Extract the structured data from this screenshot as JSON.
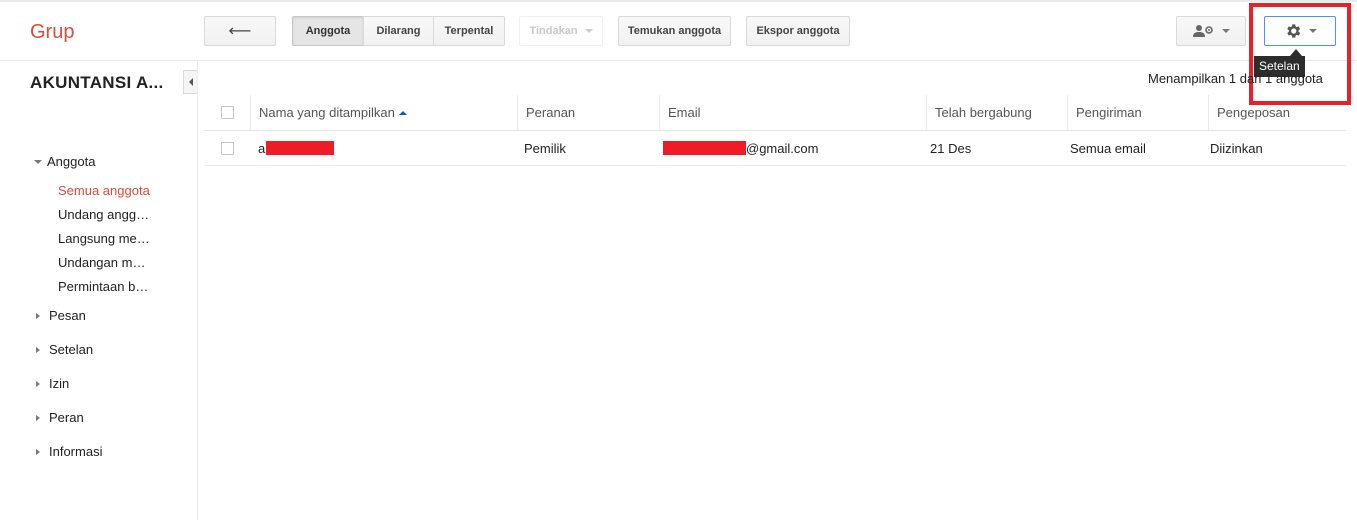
{
  "app": {
    "title": "Grup"
  },
  "toolbar": {
    "back_label": "⟵",
    "tabs": [
      {
        "label": "Anggota",
        "selected": true
      },
      {
        "label": "Dilarang",
        "selected": false
      },
      {
        "label": "Terpental",
        "selected": false
      }
    ],
    "actions_label": "Tindakan",
    "find_members_label": "Temukan anggota",
    "export_members_label": "Ekspor anggota",
    "add_member_icon": "person-add-icon",
    "settings_icon": "gear-icon",
    "settings_tooltip": "Setelan"
  },
  "sidebar": {
    "group_name": "AKUNTANSI A...",
    "sections": [
      {
        "label": "Anggota",
        "expanded": true
      },
      {
        "label": "Pesan",
        "expanded": false
      },
      {
        "label": "Setelan",
        "expanded": false
      },
      {
        "label": "Izin",
        "expanded": false
      },
      {
        "label": "Peran",
        "expanded": false
      },
      {
        "label": "Informasi",
        "expanded": false
      }
    ],
    "members_subitems": [
      {
        "label": "Semua anggota",
        "active": true
      },
      {
        "label": "Undang angg…",
        "active": false
      },
      {
        "label": "Langsung me…",
        "active": false
      },
      {
        "label": "Undangan m…",
        "active": false
      },
      {
        "label": "Permintaan b…",
        "active": false
      }
    ]
  },
  "main": {
    "count_label": "Menampilkan 1 dari 1 anggota",
    "table": {
      "columns": [
        "Nama yang ditampilkan",
        "Peranan",
        "Email",
        "Telah bergabung",
        "Pengiriman",
        "Pengeposan"
      ],
      "sort_column": "Nama yang ditampilkan",
      "sort_direction": "ascending",
      "rows": [
        {
          "name_prefix": "a",
          "role": "Pemilik",
          "email_suffix": "@gmail.com",
          "joined": "21 Des",
          "delivery": "Semua email",
          "posting": "Diizinkan"
        }
      ]
    }
  },
  "colors": {
    "brand": "#dd4b39",
    "highlight_box": "#e3232b",
    "redaction": "#ee1c24",
    "focus_border": "#4d90fe"
  }
}
